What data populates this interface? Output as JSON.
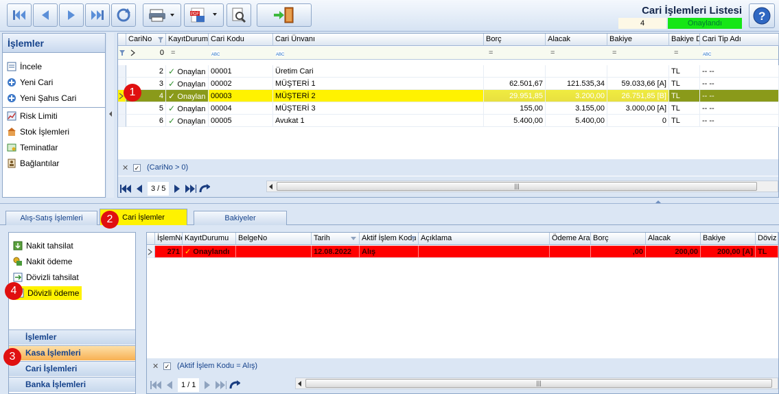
{
  "window": {
    "title": "Cari İşlemleri Listesi",
    "record_no": "4",
    "record_status": "Onaylandı"
  },
  "left_panel": {
    "header": "İşlemler",
    "items_top": [
      "İncele",
      "Yeni Cari",
      "Yeni Şahıs Cari"
    ],
    "items_bottom": [
      "Risk Limiti",
      "Stok İşlemleri",
      "Teminatlar",
      "Bağlantılar"
    ]
  },
  "top_grid": {
    "columns": [
      "CariNo",
      "KayıtDurumu",
      "Cari Kodu",
      "Cari Ünvanı",
      "Borç",
      "Alacak",
      "Bakiye",
      "Bakiye D",
      "Cari Tip Adı"
    ],
    "filter_row": {
      "carino": "0",
      "op": "="
    },
    "rows": [
      {
        "carino": "2",
        "durum": "Onaylan",
        "kod": "00001",
        "unvan": "Üretim Cari",
        "borc": "",
        "alacak": "",
        "bakiye": "",
        "doviz": "TL",
        "tip": "-- --"
      },
      {
        "carino": "3",
        "durum": "Onaylan",
        "kod": "00002",
        "unvan": "MÜŞTERİ 1",
        "borc": "62.501,67",
        "alacak": "121.535,34",
        "bakiye": "59.033,66 [A]",
        "doviz": "TL",
        "tip": "-- --"
      },
      {
        "carino": "4",
        "durum": "Onaylan",
        "kod": "00003",
        "unvan": "MÜŞTERİ 2",
        "borc": "29.951,85",
        "alacak": "3.200,00",
        "bakiye": "26.751,85 [B]",
        "doviz": "TL",
        "tip": "-- --"
      },
      {
        "carino": "5",
        "durum": "Onaylan",
        "kod": "00004",
        "unvan": "MÜŞTERİ 3",
        "borc": "155,00",
        "alacak": "3.155,00",
        "bakiye": "3.000,00 [A]",
        "doviz": "TL",
        "tip": "-- --"
      },
      {
        "carino": "6",
        "durum": "Onaylan",
        "kod": "00005",
        "unvan": "Avukat 1",
        "borc": "5.400,00",
        "alacak": "5.400,00",
        "bakiye": "0",
        "doviz": "TL",
        "tip": "-- --"
      }
    ],
    "filter_text": "(CariNo > 0)",
    "page": "3 / 5"
  },
  "tabs": [
    "Alış-Satış İşlemleri",
    "Cari İşlemler",
    "Bakiyeler"
  ],
  "bottom_left": {
    "items": [
      "Nakit tahsilat",
      "Nakit ödeme",
      "Dövizli tahsilat",
      "Dövizli ödeme"
    ],
    "sections": [
      "İşlemler",
      "Kasa İşlemleri",
      "Cari İşlemleri",
      "Banka İşlemleri"
    ]
  },
  "bottom_grid": {
    "columns": [
      "İşlemNo",
      "KayıtDurumu",
      "BelgeNo",
      "Tarih",
      "Aktif İşlem Kodu",
      "Açıklama",
      "Ödeme Aracı",
      "Borç",
      "Alacak",
      "Bakiye",
      "Döviz"
    ],
    "rows": [
      {
        "no": "271",
        "durum": "Onaylandı",
        "belge": "",
        "tarih": "12.08.2022",
        "kod": "Alış",
        "aciklama": "",
        "odeme": "",
        "borc": ",00",
        "alacak": "200,00",
        "bakiye": "200,00 [A]",
        "doviz": "TL"
      }
    ],
    "filter_text": "(Aktif İşlem Kodu = Alış)",
    "page": "1 / 1"
  },
  "badges": [
    "1",
    "2",
    "3",
    "4"
  ],
  "colors": {
    "selected_row": "#8a9a1a",
    "highlight": "#fff200",
    "red_row": "#ff0000",
    "status_green": "#16e616"
  }
}
